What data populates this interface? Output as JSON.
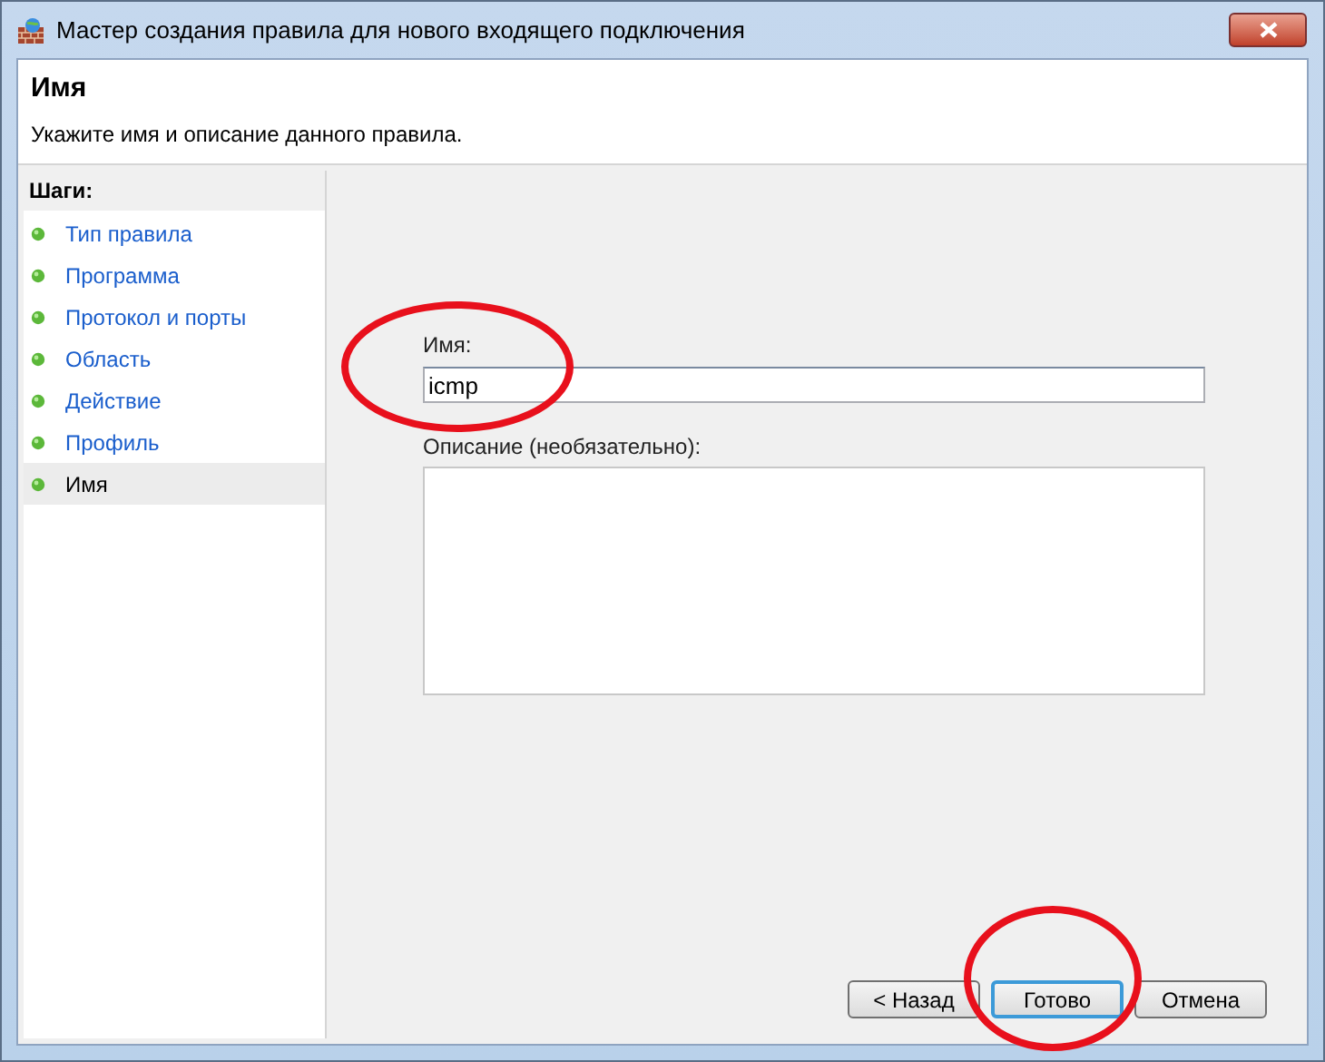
{
  "window": {
    "title": "Мастер создания правила для нового входящего подключения"
  },
  "header": {
    "title": "Имя",
    "subtitle": "Укажите имя и описание данного правила."
  },
  "steps": {
    "title": "Шаги:",
    "items": [
      {
        "label": "Тип правила",
        "selected": false
      },
      {
        "label": "Программа",
        "selected": false
      },
      {
        "label": "Протокол и порты",
        "selected": false
      },
      {
        "label": "Область",
        "selected": false
      },
      {
        "label": "Действие",
        "selected": false
      },
      {
        "label": "Профиль",
        "selected": false
      },
      {
        "label": "Имя",
        "selected": true
      }
    ]
  },
  "form": {
    "name_label": "Имя:",
    "name_value": "icmp",
    "description_label": "Описание (необязательно):"
  },
  "buttons": [
    {
      "label": "< Назад",
      "focused": false
    },
    {
      "label": "Готово",
      "focused": true
    },
    {
      "label": "Отмена",
      "focused": false
    }
  ],
  "annotations": [
    {
      "kind": "ellipse"
    },
    {
      "kind": "ellipse"
    }
  ]
}
